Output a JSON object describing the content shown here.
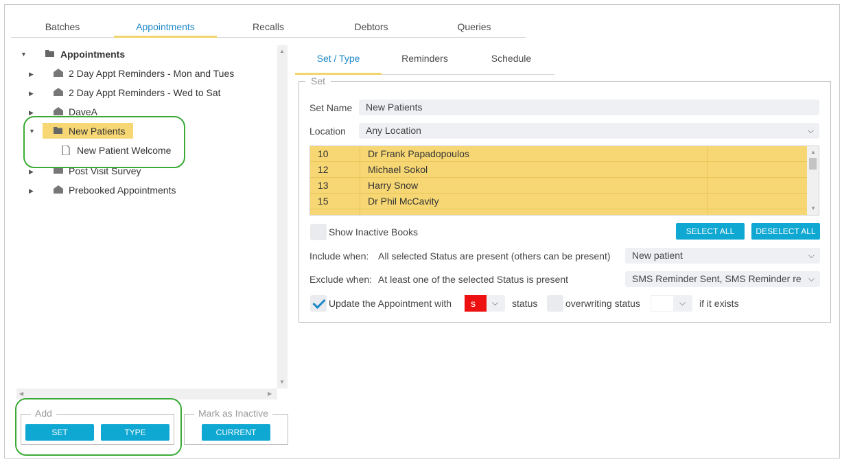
{
  "main_tabs": [
    "Batches",
    "Appointments",
    "Recalls",
    "Debtors",
    "Queries"
  ],
  "main_tab_active": "Appointments",
  "tree": {
    "root_label": "Appointments",
    "items": [
      "2 Day Appt Reminders - Mon and Tues",
      "2 Day Appt Reminders - Wed to Sat",
      "DaveA",
      "New Patients",
      "New Patient Welcome",
      "Post Visit Survey",
      "Prebooked Appointments"
    ]
  },
  "add_box": {
    "legend": "Add",
    "set_label": "SET",
    "type_label": "TYPE"
  },
  "inactive_box": {
    "legend": "Mark as Inactive",
    "current_label": "CURRENT"
  },
  "sub_tabs": [
    "Set / Type",
    "Reminders",
    "Schedule"
  ],
  "set": {
    "legend": "Set",
    "set_name_label": "Set Name",
    "set_name_value": "New Patients",
    "location_label": "Location",
    "location_value": "Any Location",
    "books": [
      {
        "id": "10",
        "name": "Dr Frank Papadopoulos"
      },
      {
        "id": "12",
        "name": "Michael Sokol"
      },
      {
        "id": "13",
        "name": "Harry Snow"
      },
      {
        "id": "15",
        "name": "Dr Phil McCavity"
      }
    ],
    "show_inactive_label": "Show Inactive Books",
    "select_all_label": "SELECT ALL",
    "deselect_all_label": "DESELECT ALL",
    "include_label": "Include when:",
    "include_text": "All selected Status are present (others can be present)",
    "include_value": "New patient",
    "exclude_label": "Exclude when:",
    "exclude_text": "At least one of the selected Status is present",
    "exclude_value": "SMS Reminder Sent, SMS Reminder re",
    "update_label": "Update the Appointment with",
    "update_status_value": "s",
    "status_label": "status",
    "overwriting_label": "overwriting status",
    "if_exists_label": "if it exists"
  },
  "colors": {
    "accent": "#1e88c8",
    "button": "#0fa8d2",
    "selection": "#f7d774",
    "highlight_ring": "#3aaa35",
    "status_red": "#ee1111"
  }
}
